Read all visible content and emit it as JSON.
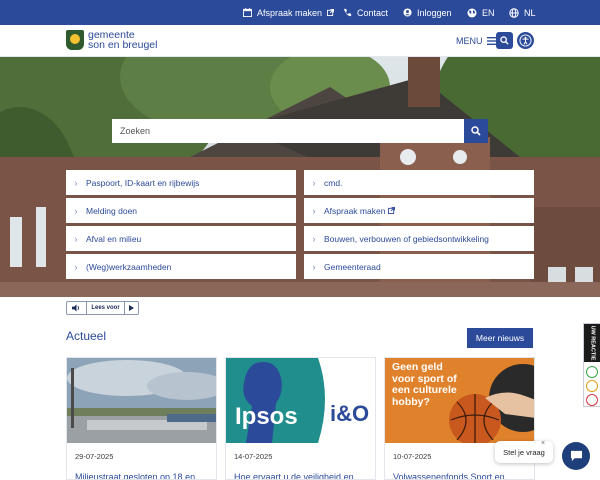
{
  "topbar": {
    "appointment": "Afspraak maken",
    "contact": "Contact",
    "login": "Inloggen",
    "lang_en": "EN",
    "lang_nl": "NL"
  },
  "header": {
    "logo_line1": "gemeente",
    "logo_line2": "son en breugel",
    "menu_label": "MENU"
  },
  "hero": {
    "search_placeholder": "Zoeken",
    "quick_links": [
      "Paspoort, ID-kaart en rijbewijs",
      "cmd.",
      "Melding doen",
      "Afspraak maken",
      "Afval en milieu",
      "Bouwen, verbouwen of gebiedsontwikkeling",
      "(Weg)werkzaamheden",
      "Gemeenteraad"
    ]
  },
  "readspeaker": {
    "label": "Lees voor"
  },
  "news": {
    "title": "Actueel",
    "more_button": "Meer nieuws",
    "cards": [
      {
        "date": "29-07-2025",
        "title": "Milieustraat gesloten op 18 en"
      },
      {
        "date": "14-07-2025",
        "title": "Hoe ervaart u de veiligheid en",
        "img_text_left": "Ipsos",
        "img_text_right": "i&O"
      },
      {
        "date": "10-07-2025",
        "title": "Volwassenenfonds Sport en",
        "img_text": [
          "Geen geld",
          "voor sport of",
          "een culturele",
          "hobby?"
        ]
      }
    ]
  },
  "feedback": {
    "label": "UW REACTIE"
  },
  "chat": {
    "prompt": "Stel je vraag",
    "close": "×"
  },
  "colors": {
    "primary": "#2b4a9a",
    "primary_dark": "#1e3f7a",
    "promo_orange": "#e0822c",
    "teal": "#1f8e8c"
  }
}
